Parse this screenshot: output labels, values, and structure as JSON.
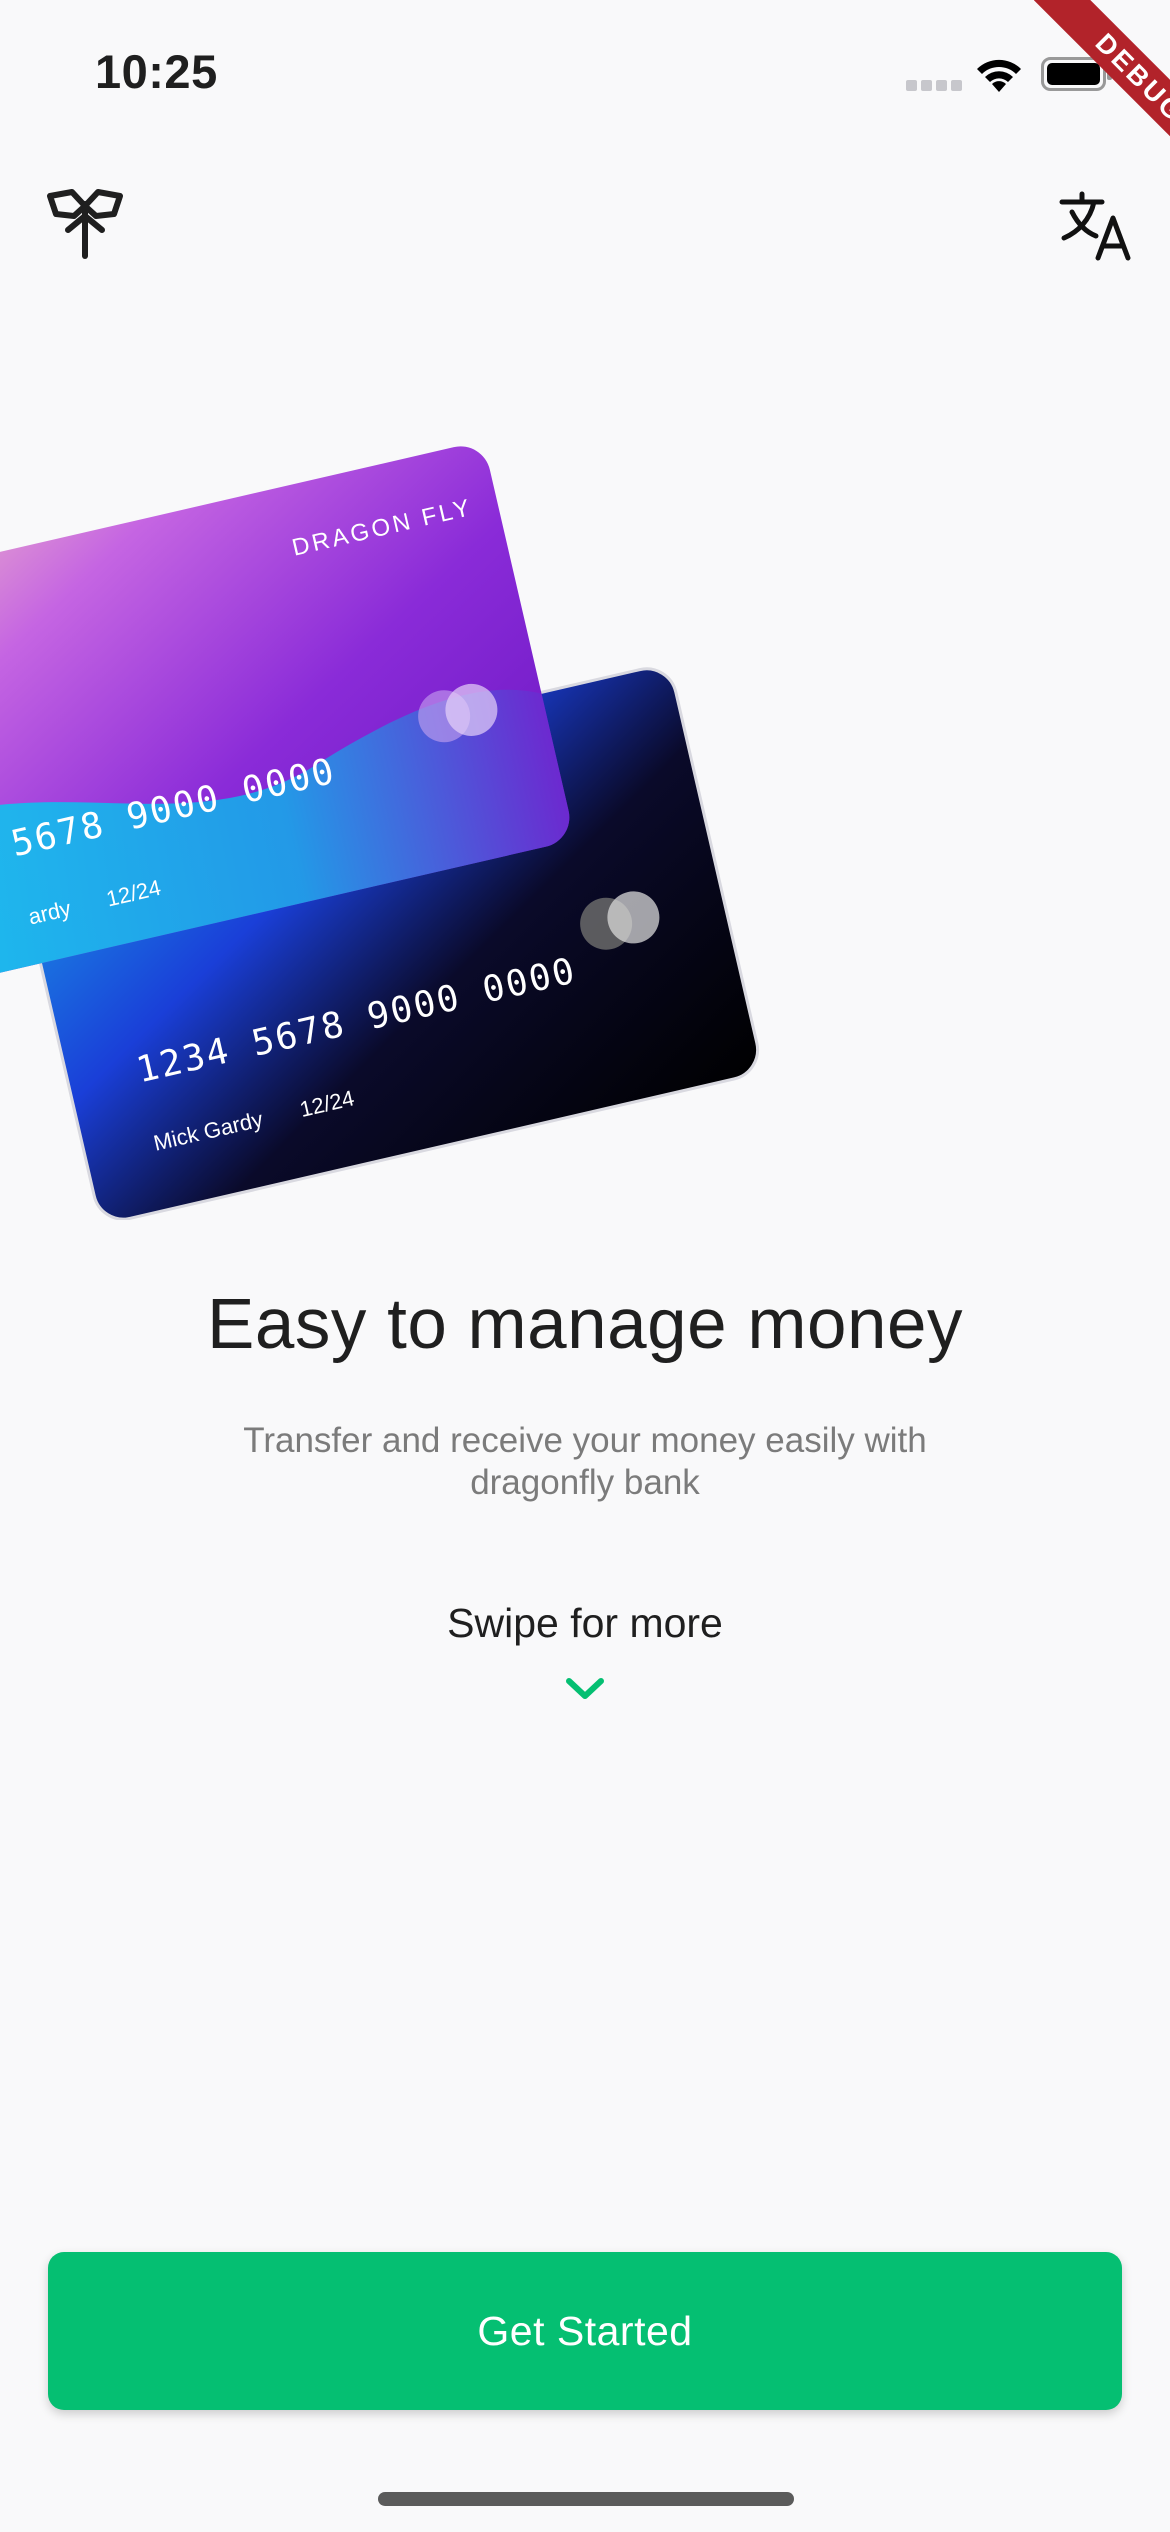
{
  "status_bar": {
    "time": "10:25",
    "debug_label": "DEBUG"
  },
  "header": {
    "logo_icon": "dragonfly-logo-icon",
    "translate_icon": "translate-icon"
  },
  "hero": {
    "front_card": {
      "brand": "DRAGON FLY",
      "number": "5678 9000 0000",
      "holder": "ardy",
      "expiry": "12/24"
    },
    "back_card": {
      "number": "1234 5678 9000 0000",
      "holder": "Mick Gardy",
      "expiry": "12/24"
    }
  },
  "onboarding": {
    "title": "Easy to manage money",
    "subtitle": "Transfer and receive your money easily with dragonfly bank",
    "swipe_hint": "Swipe for more"
  },
  "actions": {
    "get_started": "Get Started"
  },
  "colors": {
    "accent": "#05bf72",
    "background": "#f9f9fa",
    "debug_ribbon": "#b2232a"
  }
}
